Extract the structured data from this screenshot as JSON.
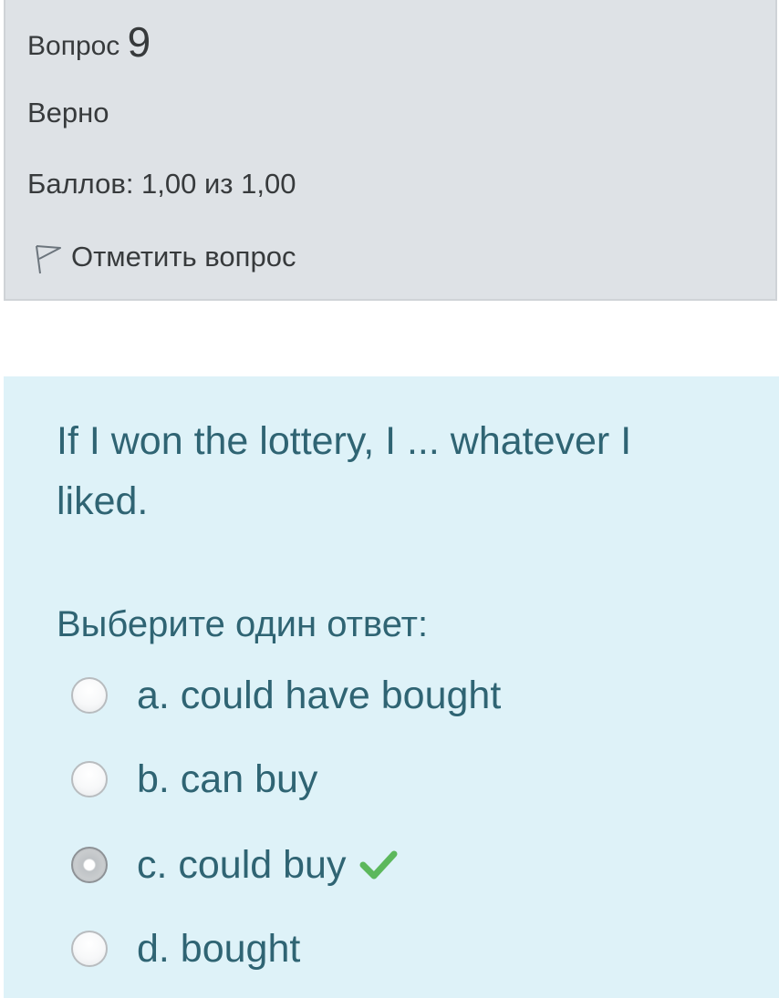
{
  "info": {
    "question_label": "Вопрос",
    "question_number": "9",
    "state": "Верно",
    "grade": "Баллов: 1,00 из 1,00",
    "flag_label": "Отметить вопрос",
    "flag_icon": "flag-outline-icon"
  },
  "question": {
    "text": "If I won the lottery, I ... whatever I liked.",
    "prompt": "Выберите один ответ:",
    "options": [
      {
        "label": "a. could have bought",
        "selected": false
      },
      {
        "label": "b. can buy",
        "selected": false
      },
      {
        "label": "c. could buy",
        "selected": true,
        "correct_icon": "checkmark-icon"
      },
      {
        "label": "d. bought",
        "selected": false
      }
    ]
  },
  "colors": {
    "info_background": "#dee2e6",
    "formulation_background": "#def2f8",
    "formulation_text": "#2f6473",
    "correct_check": "#5cb85c"
  }
}
